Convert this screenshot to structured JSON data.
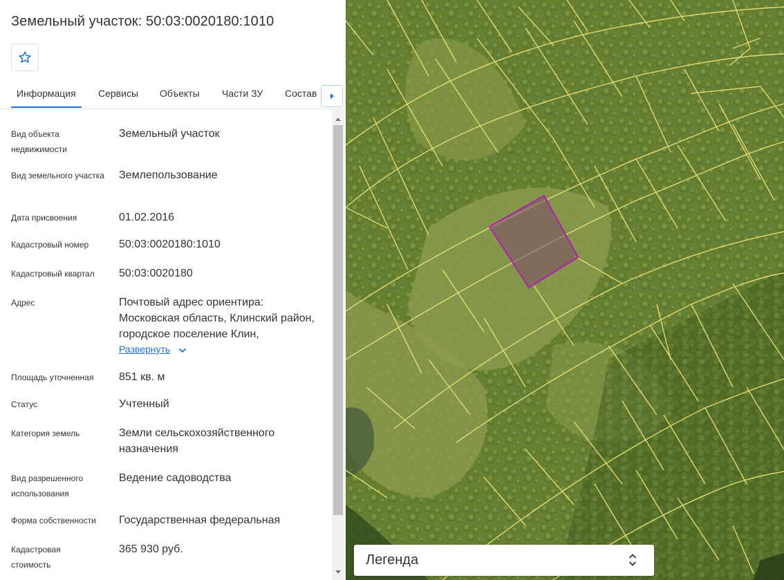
{
  "header": {
    "title": "Земельный участок: 50:03:0020180:1010"
  },
  "tabs": [
    {
      "label": "Информация",
      "active": true
    },
    {
      "label": "Сервисы"
    },
    {
      "label": "Объекты"
    },
    {
      "label": "Части ЗУ"
    },
    {
      "label": "Состав"
    }
  ],
  "info": {
    "object_type": {
      "label": "Вид объекта недвижимости",
      "value": "Земельный участок"
    },
    "land_type": {
      "label": "Вид земельного участка",
      "value": "Землепользование"
    },
    "assign_date": {
      "label": "Дата присвоения",
      "value": "01.02.2016"
    },
    "cadastral_number": {
      "label": "Кадастровый номер",
      "value": "50:03:0020180:1010"
    },
    "cadastral_quarter": {
      "label": "Кадастровый квартал",
      "value": "50:03:0020180"
    },
    "address": {
      "label": "Адрес",
      "value": "Почтовый адрес ориентира: Московская область, Клинский район, городское поселение Клин,",
      "expand_label": "Развернуть"
    },
    "area": {
      "label": "Площадь уточненная",
      "value": "851 кв. м"
    },
    "status": {
      "label": "Статус",
      "value": "Учтенный"
    },
    "land_category": {
      "label": "Категория земель",
      "value": "Земли сельскохозяйственного назначения"
    },
    "permitted_use": {
      "label": "Вид разрешенного использования",
      "value": "Ведение садоводства"
    },
    "ownership": {
      "label": "Форма собственности",
      "value": "Государственная федеральная"
    },
    "cadastral_value": {
      "label": "Кадастровая стоимость",
      "value": "365 930 руб."
    }
  },
  "map": {
    "legend_label": "Легенда",
    "parcel_line_color": "#e8e07a",
    "selected_parcel_color": "#b21fb0"
  },
  "icons": {
    "favorite": "star-outline-icon",
    "tabs_next": "caret-right-icon",
    "expand": "chevron-down-icon",
    "legend_sort": "sort-updown-icon"
  },
  "colors": {
    "accent": "#1f6ed4",
    "text": "#333333"
  }
}
